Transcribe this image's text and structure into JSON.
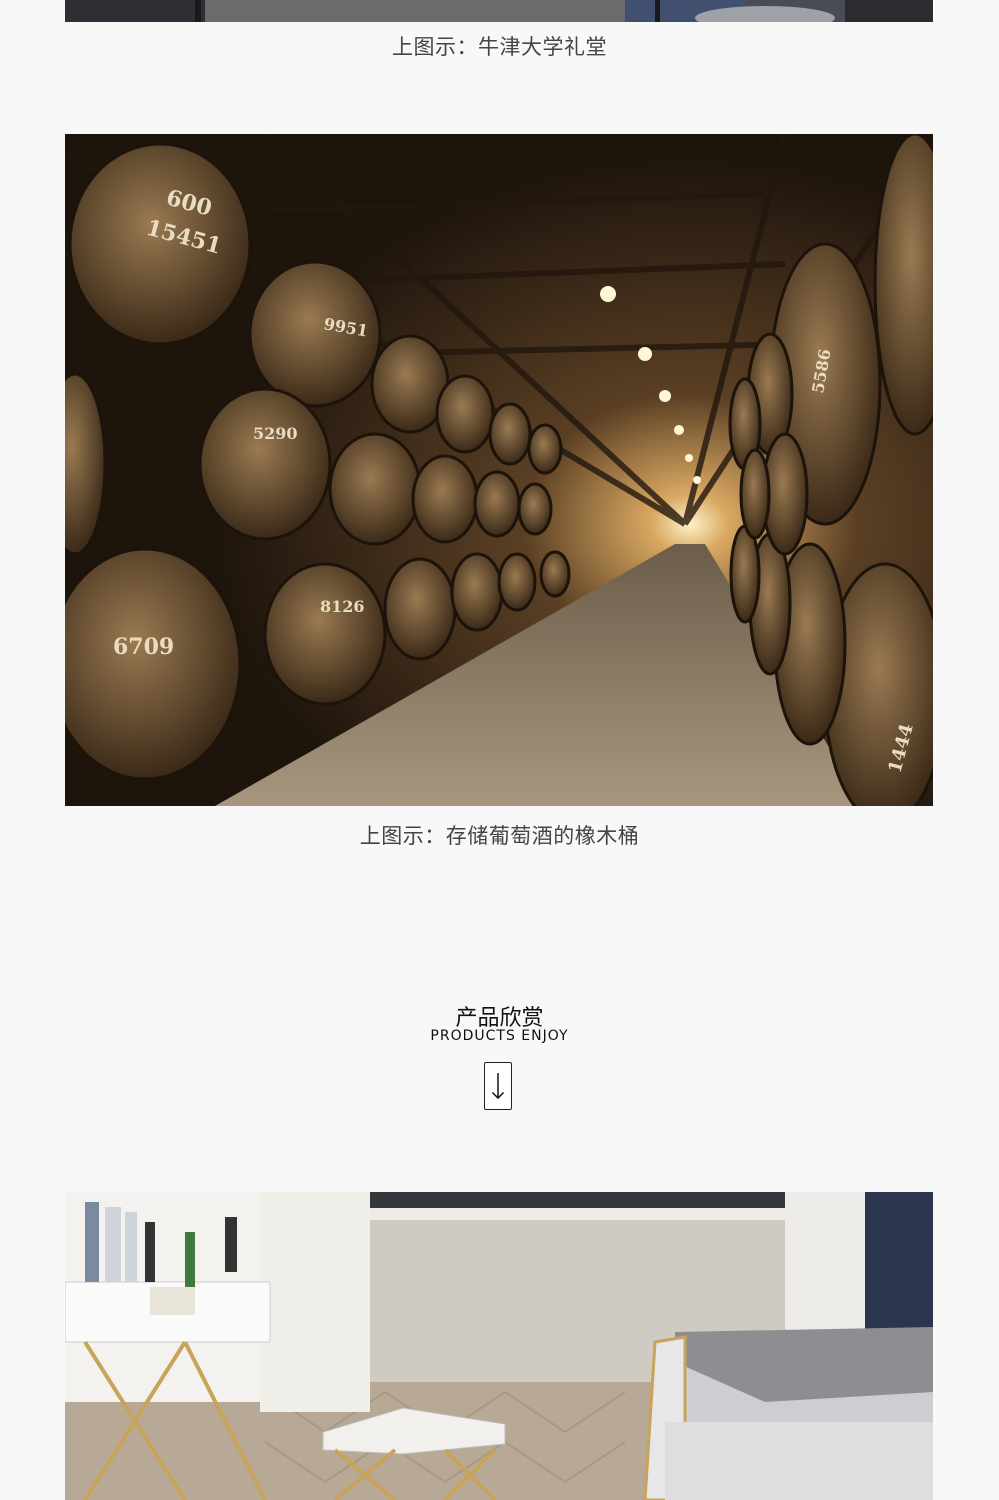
{
  "captions": {
    "top": "上图示：牛津大学礼堂",
    "barrels": "上图示：存储葡萄酒的橡木桶"
  },
  "section": {
    "title": "产品欣赏",
    "subtitle": "PRODUCTS ENJOY",
    "arrow_icon": "arrow-down-icon"
  },
  "barrel_stencils": [
    "600",
    "15451",
    "9951",
    "5290",
    "6709",
    "8126",
    "5586",
    "1444"
  ]
}
